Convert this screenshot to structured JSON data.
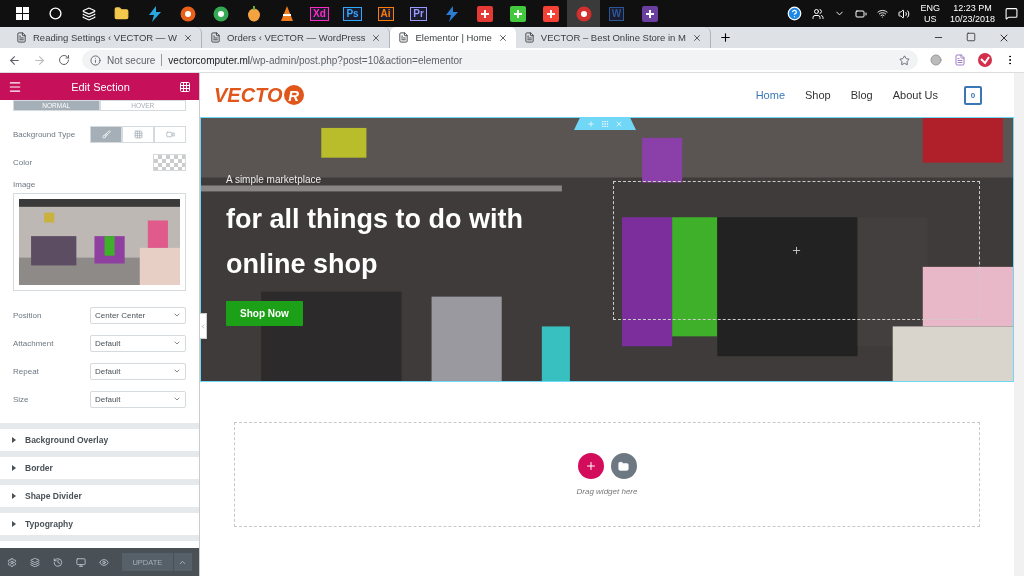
{
  "taskbar": {
    "apps": [
      {
        "kind": "folder",
        "color": "#f2c94c",
        "active": false
      },
      {
        "kind": "bolt",
        "color": "#2aa7e0",
        "active": false
      },
      {
        "kind": "circle",
        "color": "#e8611a",
        "active": false
      },
      {
        "kind": "circle",
        "color": "#34a853",
        "active": false
      },
      {
        "kind": "fruit",
        "color": "#f4a340",
        "active": false
      },
      {
        "kind": "cone",
        "color": "#f07c1b",
        "active": false
      },
      {
        "kind": "label",
        "label": "Xd",
        "color": "#ff2bc2",
        "active": false
      },
      {
        "kind": "label",
        "label": "Ps",
        "color": "#31a8ff",
        "active": false
      },
      {
        "kind": "label",
        "label": "Ai",
        "color": "#ff7c00",
        "active": false
      },
      {
        "kind": "label",
        "label": "Pr",
        "color": "#9999ff",
        "active": false
      },
      {
        "kind": "bolt",
        "color": "#2b7cd3",
        "active": false
      },
      {
        "kind": "square",
        "color": "#e53935",
        "active": false
      },
      {
        "kind": "square",
        "color": "#43c93e",
        "active": false
      },
      {
        "kind": "square",
        "color": "#f44336",
        "active": false
      },
      {
        "kind": "circle",
        "color": "#d32f2f",
        "active": true
      },
      {
        "kind": "label",
        "label": "W",
        "color": "#2b579a",
        "active": false
      },
      {
        "kind": "square",
        "color": "#6a3fa0",
        "active": false
      }
    ],
    "tray": {
      "language": "ENG",
      "region": "US",
      "time": "12:23 PM",
      "date": "10/23/2018"
    }
  },
  "browser": {
    "tabs": [
      {
        "title": "Reading Settings ‹ VECTOR — W",
        "selected": false
      },
      {
        "title": "Orders ‹ VECTOR — WordPress",
        "selected": false
      },
      {
        "title": "Elementor | Home",
        "selected": true
      },
      {
        "title": "VECTOR – Best Online Store in M",
        "selected": false
      }
    ],
    "security": "Not secure",
    "url_host": "vectorcomputer.ml",
    "url_path": "/wp-admin/post.php?post=10&action=elementor"
  },
  "panel": {
    "title": "Edit Section",
    "state_tabs": [
      {
        "label": "NORMAL",
        "selected": true
      },
      {
        "label": "HOVER",
        "selected": false
      }
    ],
    "background_type": {
      "label": "Background Type",
      "options": [
        {
          "kind": "brush",
          "selected": true
        },
        {
          "kind": "gradient",
          "selected": false
        },
        {
          "kind": "video",
          "selected": false
        }
      ]
    },
    "color_label": "Color",
    "image_label": "Image",
    "selects": [
      {
        "label": "Position",
        "value": "Center Center"
      },
      {
        "label": "Attachment",
        "value": "Default"
      },
      {
        "label": "Repeat",
        "value": "Default"
      },
      {
        "label": "Size",
        "value": "Default"
      }
    ],
    "sections": [
      {
        "title": "Background Overlay",
        "expanded": false
      },
      {
        "title": "Border",
        "expanded": false
      },
      {
        "title": "Shape Divider",
        "expanded": false
      },
      {
        "title": "Typography",
        "expanded": false
      }
    ],
    "update_button": "UPDATE"
  },
  "site": {
    "logo": "VECTO",
    "logo_badge": "R",
    "nav": [
      {
        "label": "Home",
        "selected": true
      },
      {
        "label": "Shop",
        "selected": false
      },
      {
        "label": "Blog",
        "selected": false
      },
      {
        "label": "About Us",
        "selected": false
      }
    ],
    "cart_count": "0",
    "hero": {
      "kicker": "A simple marketplace",
      "heading": "for all things to do with online shop",
      "button": "Shop Now"
    },
    "drop_zone": {
      "hint": "Drag widget here"
    }
  }
}
